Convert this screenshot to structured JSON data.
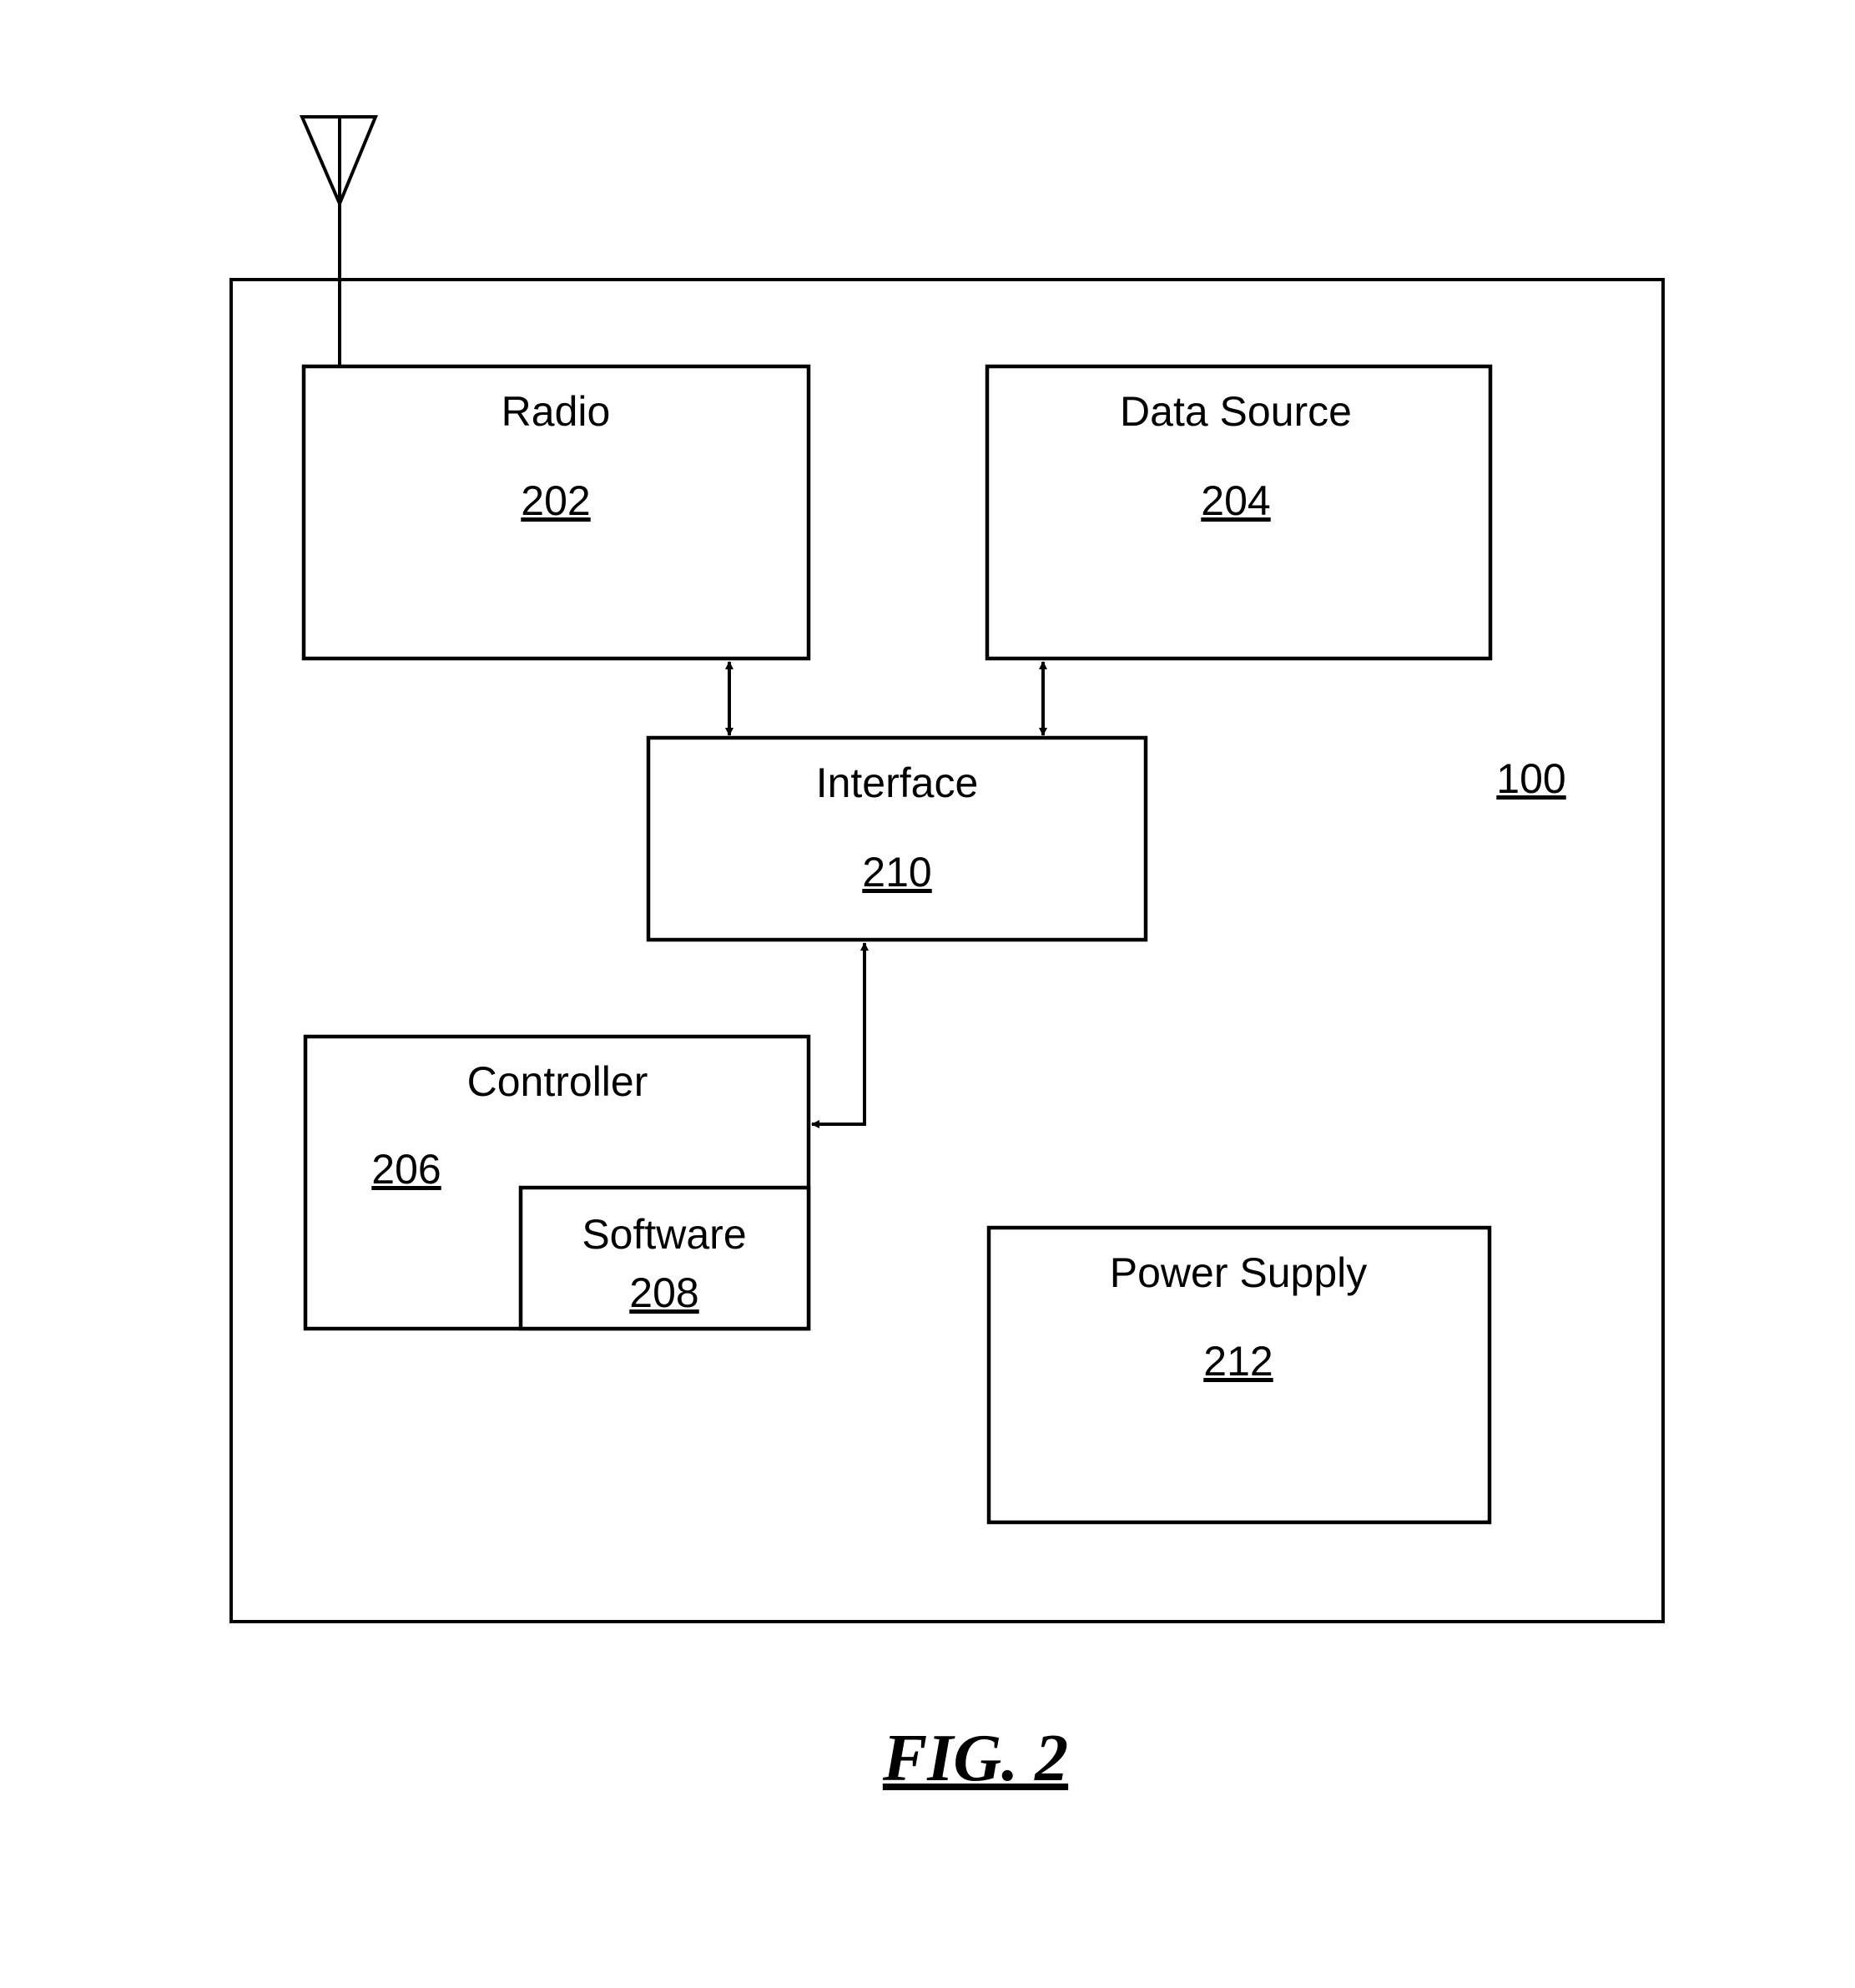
{
  "figure": {
    "caption": "FIG. 2",
    "device_ref": "100"
  },
  "blocks": {
    "radio": {
      "title": "Radio",
      "ref": "202"
    },
    "data_source": {
      "title": "Data Source",
      "ref": "204"
    },
    "controller": {
      "title": "Controller",
      "ref": "206"
    },
    "software": {
      "title": "Software",
      "ref": "208"
    },
    "interface": {
      "title": "Interface",
      "ref": "210"
    },
    "power_supply": {
      "title": "Power Supply",
      "ref": "212"
    }
  },
  "connections": [
    {
      "from": "radio",
      "to": "interface",
      "type": "bidirectional"
    },
    {
      "from": "data_source",
      "to": "interface",
      "type": "bidirectional"
    },
    {
      "from": "interface",
      "to": "controller",
      "type": "bidirectional"
    }
  ],
  "antenna": {
    "attached_to": "radio"
  }
}
